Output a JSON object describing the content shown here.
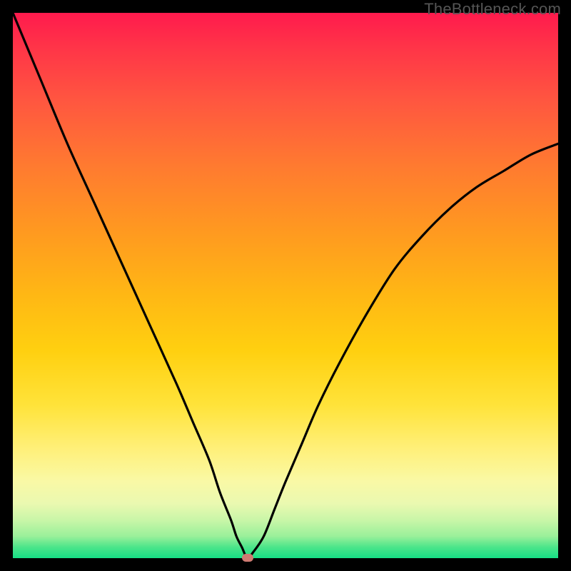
{
  "watermark": "TheBottleneck.com",
  "colors": {
    "frame": "#000000",
    "curve": "#000000",
    "marker": "#cf7a72",
    "gradient_top": "#ff1a4d",
    "gradient_bottom": "#16df85"
  },
  "chart_data": {
    "type": "line",
    "title": "",
    "xlabel": "",
    "ylabel": "",
    "xlim": [
      0,
      100
    ],
    "ylim": [
      0,
      100
    ],
    "grid": false,
    "legend": false,
    "series": [
      {
        "name": "bottleneck-curve",
        "x": [
          0,
          5,
          10,
          15,
          20,
          25,
          30,
          33,
          36,
          38,
          40,
          41,
          42,
          43,
          44,
          46,
          48,
          50,
          53,
          56,
          60,
          65,
          70,
          75,
          80,
          85,
          90,
          95,
          100
        ],
        "values": [
          100,
          88,
          76,
          65,
          54,
          43,
          32,
          25,
          18,
          12,
          7,
          4,
          2,
          0,
          1,
          4,
          9,
          14,
          21,
          28,
          36,
          45,
          53,
          59,
          64,
          68,
          71,
          74,
          76
        ]
      }
    ],
    "marker": {
      "x": 43,
      "y": 0
    },
    "notes": "Axes and gridlines are not rendered; values are visual estimates read from the curve shape against the plot extents."
  }
}
